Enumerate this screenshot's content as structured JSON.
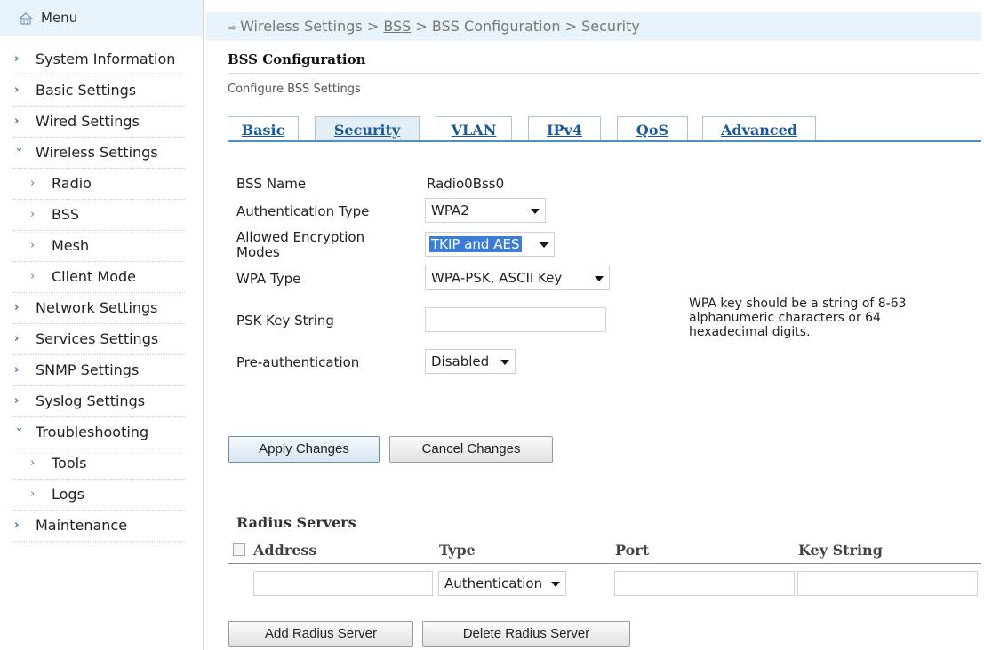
{
  "sidebar": {
    "header": "Menu",
    "items": [
      {
        "label": "System Information",
        "sub": false,
        "expanded": false
      },
      {
        "label": "Basic Settings",
        "sub": false,
        "expanded": false
      },
      {
        "label": "Wired Settings",
        "sub": false,
        "expanded": false
      },
      {
        "label": "Wireless Settings",
        "sub": false,
        "expanded": true
      },
      {
        "label": "Radio",
        "sub": true
      },
      {
        "label": "BSS",
        "sub": true
      },
      {
        "label": "Mesh",
        "sub": true
      },
      {
        "label": "Client Mode",
        "sub": true
      },
      {
        "label": "Network Settings",
        "sub": false,
        "expanded": false
      },
      {
        "label": "Services Settings",
        "sub": false,
        "expanded": false
      },
      {
        "label": "SNMP Settings",
        "sub": false,
        "expanded": false
      },
      {
        "label": "Syslog Settings",
        "sub": false,
        "expanded": false
      },
      {
        "label": "Troubleshooting",
        "sub": false,
        "expanded": true
      },
      {
        "label": "Tools",
        "sub": true
      },
      {
        "label": "Logs",
        "sub": true
      },
      {
        "label": "Maintenance",
        "sub": false,
        "expanded": false
      }
    ]
  },
  "breadcrumb": {
    "first": "Wireless Settings",
    "sep": ">",
    "link": "BSS",
    "third": "BSS Configuration",
    "fourth": "Security"
  },
  "page": {
    "title": "BSS Configuration",
    "subtitle": "Configure BSS Settings"
  },
  "tabs": [
    "Basic",
    "Security",
    "VLAN",
    "IPv4",
    "QoS",
    "Advanced"
  ],
  "active_tab": "Security",
  "form": {
    "bss_name_label": "BSS Name",
    "bss_name_value": "Radio0Bss0",
    "auth_type_label": "Authentication Type",
    "auth_type_value": "WPA2",
    "enc_modes_label_1": "Allowed Encryption",
    "enc_modes_label_2": "Modes",
    "enc_modes_value": "TKIP and AES",
    "wpa_type_label": "WPA Type",
    "wpa_type_value": "WPA-PSK, ASCII Key",
    "psk_label": "PSK Key String",
    "psk_value": "",
    "preauth_label": "Pre-authentication",
    "preauth_value": "Disabled",
    "psk_note": "WPA key should be a string of 8-63 alphanumeric characters or 64 hexadecimal digits."
  },
  "buttons": {
    "apply": "Apply Changes",
    "cancel": "Cancel Changes",
    "add_radius": "Add Radius Server",
    "delete_radius": "Delete Radius Server"
  },
  "radius": {
    "title": "Radius Servers",
    "col_address": "Address",
    "col_type": "Type",
    "col_port": "Port",
    "col_key": "Key String",
    "row_type_value": "Authentication"
  },
  "colors": {
    "accent": "#1a5a9a",
    "header_bg": "#e9f3fb",
    "selection": "#3b7dd8"
  }
}
